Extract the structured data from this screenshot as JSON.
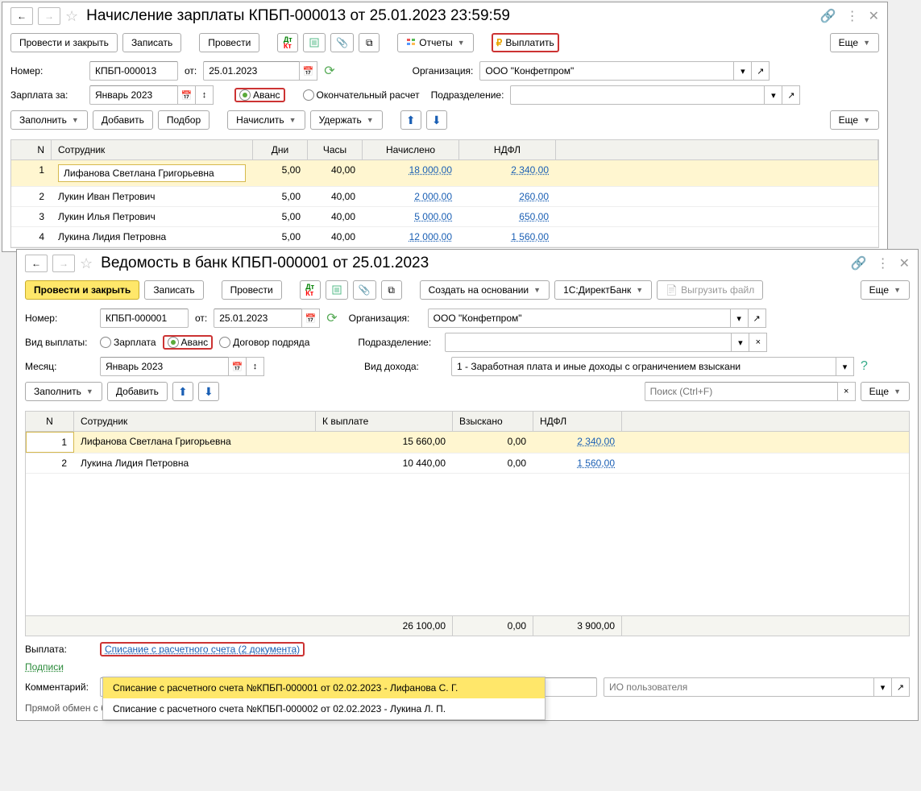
{
  "w1": {
    "title": "Начисление зарплаты КПБП-000013 от 25.01.2023 23:59:59",
    "toolbar": {
      "post_close": "Провести и закрыть",
      "save": "Записать",
      "post": "Провести",
      "reports": "Отчеты",
      "pay": "Выплатить",
      "more": "Еще"
    },
    "fields": {
      "number_lbl": "Номер:",
      "number": "КПБП-000013",
      "from_lbl": "от:",
      "date": "25.01.2023",
      "org_lbl": "Организация:",
      "org": "ООО \"Конфетпром\"",
      "salary_for_lbl": "Зарплата за:",
      "period": "Январь 2023",
      "radio_avans": "Аванс",
      "radio_final": "Окончательный расчет",
      "dept_lbl": "Подразделение:",
      "dept": ""
    },
    "toolbar2": {
      "fill": "Заполнить",
      "add": "Добавить",
      "pick": "Подбор",
      "accrue": "Начислить",
      "hold": "Удержать",
      "more": "Еще"
    },
    "cols": {
      "n": "N",
      "emp": "Сотрудник",
      "days": "Дни",
      "hours": "Часы",
      "accrued": "Начислено",
      "ndfl": "НДФЛ"
    },
    "rows": [
      {
        "n": "1",
        "emp": "Лифанова Светлана Григорьевна",
        "d": "5,00",
        "h": "40,00",
        "acc": "18 000,00",
        "ndfl": "2 340,00",
        "sel": true
      },
      {
        "n": "2",
        "emp": "Лукин Иван Петрович",
        "d": "5,00",
        "h": "40,00",
        "acc": "2 000,00",
        "ndfl": "260,00"
      },
      {
        "n": "3",
        "emp": "Лукин Илья Петрович",
        "d": "5,00",
        "h": "40,00",
        "acc": "5 000,00",
        "ndfl": "650,00"
      },
      {
        "n": "4",
        "emp": "Лукина Лидия Петровна",
        "d": "5,00",
        "h": "40,00",
        "acc": "12 000,00",
        "ndfl": "1 560,00"
      }
    ]
  },
  "w2": {
    "title": "Ведомость в банк КПБП-000001 от 25.01.2023",
    "toolbar": {
      "post_close": "Провести и закрыть",
      "save": "Записать",
      "post": "Провести",
      "create_on": "Создать на основании",
      "direct": "1С:ДиректБанк",
      "export": "Выгрузить файл",
      "more": "Еще"
    },
    "fields": {
      "number_lbl": "Номер:",
      "number": "КПБП-000001",
      "from_lbl": "от:",
      "date": "25.01.2023",
      "org_lbl": "Организация:",
      "org": "ООО \"Конфетпром\"",
      "type_lbl": "Вид выплаты:",
      "r_salary": "Зарплата",
      "r_avans": "Аванс",
      "r_contract": "Договор подряда",
      "dept_lbl": "Подразделение:",
      "dept": "",
      "month_lbl": "Месяц:",
      "month": "Январь 2023",
      "income_lbl": "Вид дохода:",
      "income": "1 - Заработная плата и иные доходы с ограничением взыскани"
    },
    "toolbar2": {
      "fill": "Заполнить",
      "add": "Добавить",
      "search_ph": "Поиск (Ctrl+F)",
      "more": "Еще"
    },
    "cols": {
      "n": "N",
      "emp": "Сотрудник",
      "pay": "К выплате",
      "col": "Взыскано",
      "ndfl": "НДФЛ"
    },
    "rows": [
      {
        "n": "1",
        "emp": "Лифанова Светлана Григорьевна",
        "pay": "15 660,00",
        "col": "0,00",
        "ndfl": "2 340,00",
        "sel": true
      },
      {
        "n": "2",
        "emp": "Лукина Лидия Петровна",
        "pay": "10 440,00",
        "col": "0,00",
        "ndfl": "1 560,00"
      }
    ],
    "totals": {
      "pay": "26 100,00",
      "col": "0,00",
      "ndfl": "3 900,00"
    },
    "footer": {
      "payout_lbl": "Выплата:",
      "payout_link": "Списание с расчетного счета (2 документа)",
      "sign_link": "Подписи",
      "comment_lbl": "Комментарий:",
      "comment": "",
      "user_ph": "ИО пользователя",
      "warn": "Прямой обмен с банком не подключен"
    },
    "popup": {
      "item1": "Списание с расчетного счета №КПБП-000001 от 02.02.2023 - Лифанова С. Г.",
      "item2": "Списание с расчетного счета №КПБП-000002 от 02.02.2023 - Лукина Л. П."
    }
  }
}
